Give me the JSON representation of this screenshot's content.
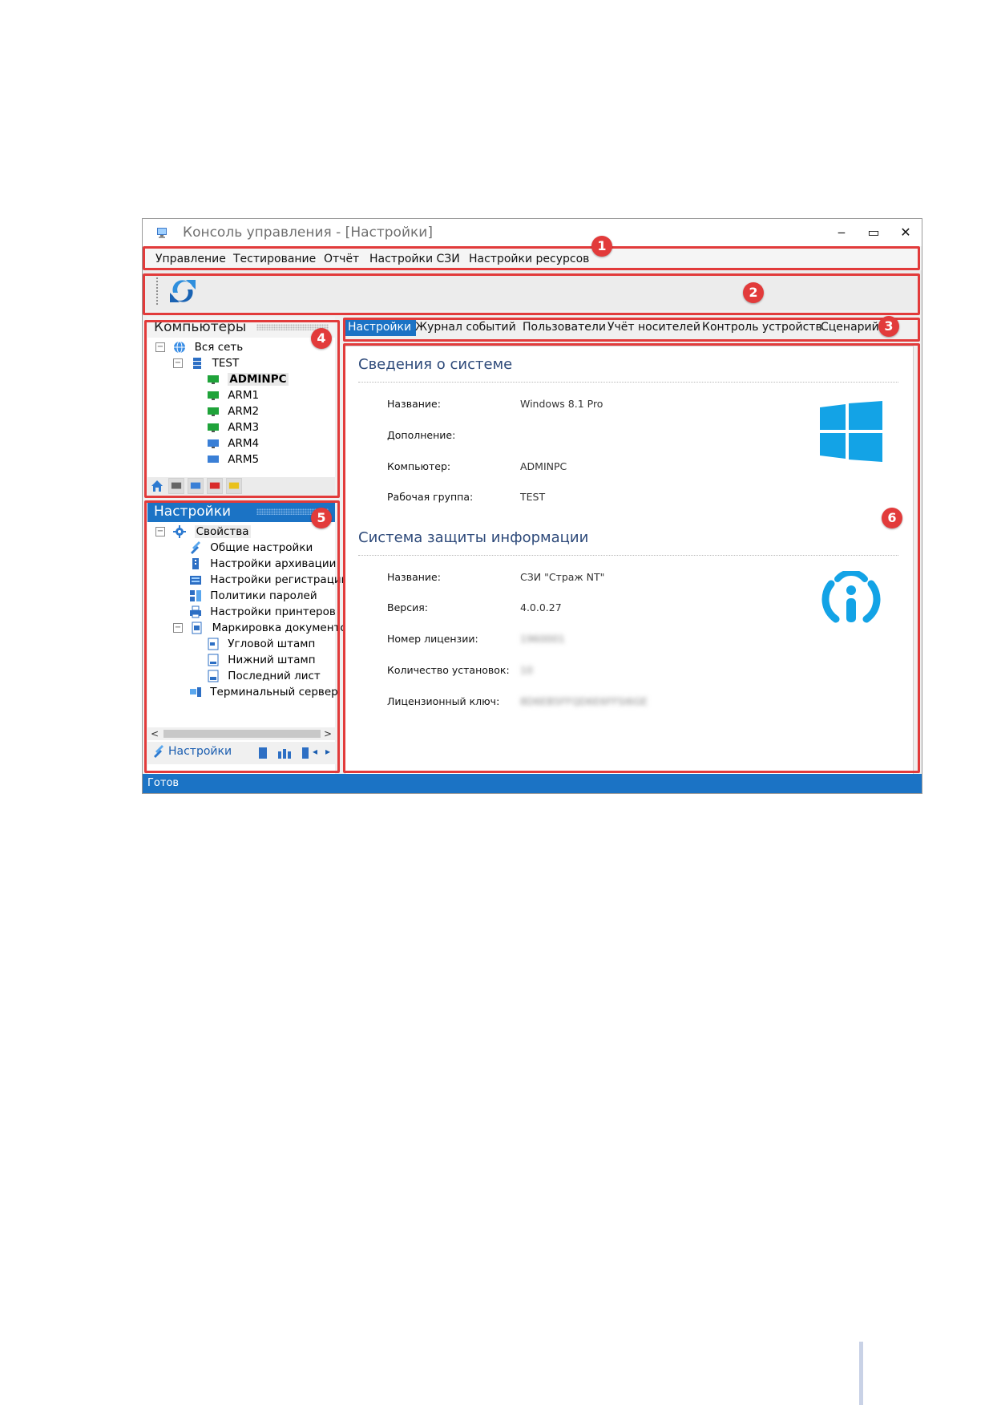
{
  "window": {
    "title": "Консоль управления - [Настройки]",
    "controls": [
      "‒",
      "▭",
      "✕"
    ]
  },
  "menu": [
    "Управление",
    "Тестирование",
    "Отчёт",
    "Настройки СЗИ",
    "Настройки ресурсов"
  ],
  "computers_panel": {
    "title": "Компьютеры",
    "tree": [
      {
        "label": "Вся сеть",
        "icon": "network-icon",
        "expander": "⊟"
      },
      {
        "label": "TEST",
        "icon": "server-icon",
        "expander": "⊟"
      },
      {
        "label": "ADMINPC",
        "icon": "computer-green-icon",
        "selected": true
      },
      {
        "label": "ARM1",
        "icon": "computer-green-icon"
      },
      {
        "label": "ARM2",
        "icon": "computer-green-icon"
      },
      {
        "label": "ARM3",
        "icon": "computer-green-icon"
      },
      {
        "label": "ARM4",
        "icon": "computer-blue-icon"
      },
      {
        "label": "ARM5",
        "icon": "computer-blue-icon"
      }
    ]
  },
  "settings_panel": {
    "title": "Настройки",
    "tree": [
      {
        "label": "Свойства",
        "icon": "gear-icon",
        "expander": "⊟"
      },
      {
        "label": "Общие настройки",
        "icon": "tools-icon"
      },
      {
        "label": "Настройки архивации",
        "icon": "archive-icon"
      },
      {
        "label": "Настройки регистрации",
        "icon": "log-icon"
      },
      {
        "label": "Политики паролей",
        "icon": "password-icon"
      },
      {
        "label": "Настройки принтеров",
        "icon": "printer-icon"
      },
      {
        "label": "Маркировка документов",
        "icon": "document-icon",
        "expander": "⊟"
      },
      {
        "label": "Угловой штамп",
        "icon": "stamp-icon"
      },
      {
        "label": "Нижний штамп",
        "icon": "stamp-icon"
      },
      {
        "label": "Последний лист",
        "icon": "stamp-icon"
      },
      {
        "label": "Терминальный сервер",
        "icon": "terminal-server-icon"
      }
    ],
    "nav_label": "Настройки"
  },
  "tabs": [
    "Настройки",
    "Журнал событий",
    "Пользователи",
    "Учёт носителей",
    "Контроль устройств",
    "Сценарий"
  ],
  "system_info": {
    "title": "Сведения о системе",
    "rows": [
      {
        "label": "Название:",
        "value": "Windows 8.1 Pro"
      },
      {
        "label": "Дополнение:",
        "value": ""
      },
      {
        "label": "Компьютер:",
        "value": "ADMINPC"
      },
      {
        "label": "Рабочая группа:",
        "value": "TEST"
      }
    ]
  },
  "security_info": {
    "title": "Система защиты информации",
    "rows": [
      {
        "label": "Название:",
        "value": "СЗИ \"Страж NT\""
      },
      {
        "label": "Версия:",
        "value": "4.0.0.27"
      },
      {
        "label": "Номер лицензии:",
        "value": "1960001"
      },
      {
        "label": "Количество установок:",
        "value": "10"
      },
      {
        "label": "Лицензионный ключ:",
        "value": "8D6EB5FFQD6E6FFSI6GE"
      }
    ]
  },
  "status": "Готов",
  "badges": [
    "1",
    "2",
    "3",
    "4",
    "5",
    "6"
  ],
  "colors": {
    "accent": "#1b73c5",
    "highlight": "#e23b3b"
  }
}
